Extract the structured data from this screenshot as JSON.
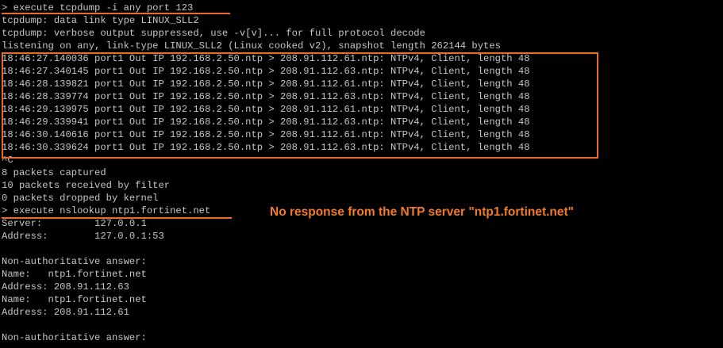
{
  "terminal": {
    "lines": [
      "> execute tcpdump -i any port 123",
      "tcpdump: data link type LINUX_SLL2",
      "tcpdump: verbose output suppressed, use -v[v]... for full protocol decode",
      "listening on any, link-type LINUX_SLL2 (Linux cooked v2), snapshot length 262144 bytes",
      "18:46:27.140036 port1 Out IP 192.168.2.50.ntp > 208.91.112.61.ntp: NTPv4, Client, length 48",
      "18:46:27.340145 port1 Out IP 192.168.2.50.ntp > 208.91.112.63.ntp: NTPv4, Client, length 48",
      "18:46:28.139821 port1 Out IP 192.168.2.50.ntp > 208.91.112.61.ntp: NTPv4, Client, length 48",
      "18:46:28.339774 port1 Out IP 192.168.2.50.ntp > 208.91.112.63.ntp: NTPv4, Client, length 48",
      "18:46:29.139975 port1 Out IP 192.168.2.50.ntp > 208.91.112.61.ntp: NTPv4, Client, length 48",
      "18:46:29.339941 port1 Out IP 192.168.2.50.ntp > 208.91.112.63.ntp: NTPv4, Client, length 48",
      "18:46:30.140616 port1 Out IP 192.168.2.50.ntp > 208.91.112.61.ntp: NTPv4, Client, length 48",
      "18:46:30.339624 port1 Out IP 192.168.2.50.ntp > 208.91.112.63.ntp: NTPv4, Client, length 48",
      "^C",
      "8 packets captured",
      "10 packets received by filter",
      "0 packets dropped by kernel",
      "> execute nslookup ntp1.fortinet.net",
      "Server:         127.0.0.1",
      "Address:        127.0.0.1:53",
      "",
      "Non-authoritative answer:",
      "Name:   ntp1.fortinet.net",
      "Address: 208.91.112.63",
      "Name:   ntp1.fortinet.net",
      "Address: 208.91.112.61",
      "",
      "Non-authoritative answer:"
    ]
  },
  "annotation": {
    "text": "No response from the NTP server \"ntp1.fortinet.net\""
  },
  "colors": {
    "background": "#000000",
    "terminal_text": "#c6c6c6",
    "accent": "#e86b2a"
  }
}
